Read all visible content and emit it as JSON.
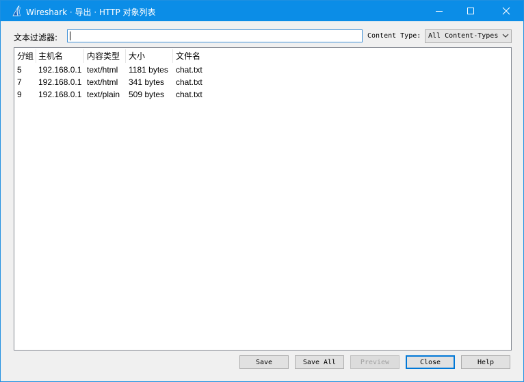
{
  "window": {
    "title": "Wireshark · 导出 · HTTP 对象列表"
  },
  "filter": {
    "label": "文本过滤器:",
    "value": ""
  },
  "content_type": {
    "label": "Content Type:",
    "selected": "All Content-Types"
  },
  "table": {
    "columns": [
      "分组",
      "主机名",
      "内容类型",
      "大小",
      "文件名"
    ],
    "rows": [
      [
        "5",
        "192.168.0.1",
        "text/html",
        "1181 bytes",
        "chat.txt"
      ],
      [
        "7",
        "192.168.0.1",
        "text/html",
        "341 bytes",
        "chat.txt"
      ],
      [
        "9",
        "192.168.0.1",
        "text/plain",
        "509 bytes",
        "chat.txt"
      ]
    ]
  },
  "buttons": {
    "save": "Save",
    "save_all": "Save All",
    "preview": "Preview",
    "close": "Close",
    "help": "Help"
  },
  "colors": {
    "titlebar": "#0b8de7",
    "input_border": "#3c8fd6",
    "default_button_border": "#0078d7"
  }
}
